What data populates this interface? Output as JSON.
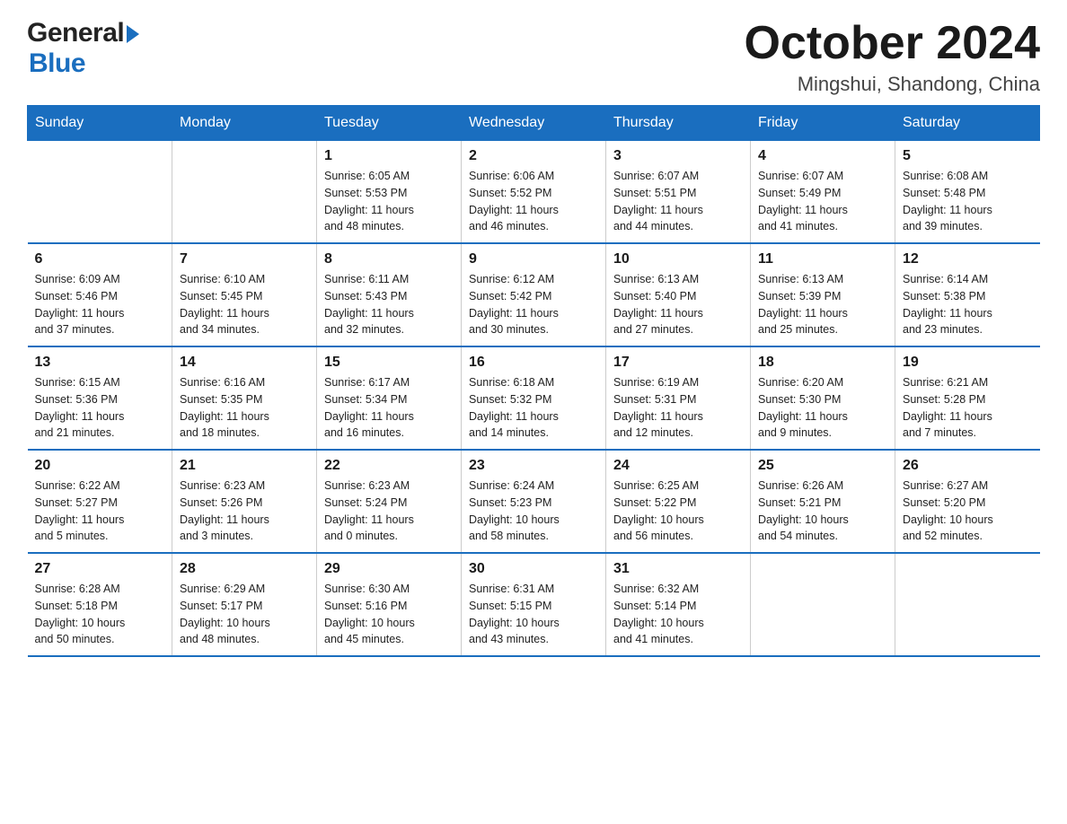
{
  "header": {
    "logo_general": "General",
    "logo_blue": "Blue",
    "month_title": "October 2024",
    "location": "Mingshui, Shandong, China"
  },
  "calendar": {
    "days_of_week": [
      "Sunday",
      "Monday",
      "Tuesday",
      "Wednesday",
      "Thursday",
      "Friday",
      "Saturday"
    ],
    "weeks": [
      [
        {
          "day": "",
          "info": ""
        },
        {
          "day": "",
          "info": ""
        },
        {
          "day": "1",
          "info": "Sunrise: 6:05 AM\nSunset: 5:53 PM\nDaylight: 11 hours\nand 48 minutes."
        },
        {
          "day": "2",
          "info": "Sunrise: 6:06 AM\nSunset: 5:52 PM\nDaylight: 11 hours\nand 46 minutes."
        },
        {
          "day": "3",
          "info": "Sunrise: 6:07 AM\nSunset: 5:51 PM\nDaylight: 11 hours\nand 44 minutes."
        },
        {
          "day": "4",
          "info": "Sunrise: 6:07 AM\nSunset: 5:49 PM\nDaylight: 11 hours\nand 41 minutes."
        },
        {
          "day": "5",
          "info": "Sunrise: 6:08 AM\nSunset: 5:48 PM\nDaylight: 11 hours\nand 39 minutes."
        }
      ],
      [
        {
          "day": "6",
          "info": "Sunrise: 6:09 AM\nSunset: 5:46 PM\nDaylight: 11 hours\nand 37 minutes."
        },
        {
          "day": "7",
          "info": "Sunrise: 6:10 AM\nSunset: 5:45 PM\nDaylight: 11 hours\nand 34 minutes."
        },
        {
          "day": "8",
          "info": "Sunrise: 6:11 AM\nSunset: 5:43 PM\nDaylight: 11 hours\nand 32 minutes."
        },
        {
          "day": "9",
          "info": "Sunrise: 6:12 AM\nSunset: 5:42 PM\nDaylight: 11 hours\nand 30 minutes."
        },
        {
          "day": "10",
          "info": "Sunrise: 6:13 AM\nSunset: 5:40 PM\nDaylight: 11 hours\nand 27 minutes."
        },
        {
          "day": "11",
          "info": "Sunrise: 6:13 AM\nSunset: 5:39 PM\nDaylight: 11 hours\nand 25 minutes."
        },
        {
          "day": "12",
          "info": "Sunrise: 6:14 AM\nSunset: 5:38 PM\nDaylight: 11 hours\nand 23 minutes."
        }
      ],
      [
        {
          "day": "13",
          "info": "Sunrise: 6:15 AM\nSunset: 5:36 PM\nDaylight: 11 hours\nand 21 minutes."
        },
        {
          "day": "14",
          "info": "Sunrise: 6:16 AM\nSunset: 5:35 PM\nDaylight: 11 hours\nand 18 minutes."
        },
        {
          "day": "15",
          "info": "Sunrise: 6:17 AM\nSunset: 5:34 PM\nDaylight: 11 hours\nand 16 minutes."
        },
        {
          "day": "16",
          "info": "Sunrise: 6:18 AM\nSunset: 5:32 PM\nDaylight: 11 hours\nand 14 minutes."
        },
        {
          "day": "17",
          "info": "Sunrise: 6:19 AM\nSunset: 5:31 PM\nDaylight: 11 hours\nand 12 minutes."
        },
        {
          "day": "18",
          "info": "Sunrise: 6:20 AM\nSunset: 5:30 PM\nDaylight: 11 hours\nand 9 minutes."
        },
        {
          "day": "19",
          "info": "Sunrise: 6:21 AM\nSunset: 5:28 PM\nDaylight: 11 hours\nand 7 minutes."
        }
      ],
      [
        {
          "day": "20",
          "info": "Sunrise: 6:22 AM\nSunset: 5:27 PM\nDaylight: 11 hours\nand 5 minutes."
        },
        {
          "day": "21",
          "info": "Sunrise: 6:23 AM\nSunset: 5:26 PM\nDaylight: 11 hours\nand 3 minutes."
        },
        {
          "day": "22",
          "info": "Sunrise: 6:23 AM\nSunset: 5:24 PM\nDaylight: 11 hours\nand 0 minutes."
        },
        {
          "day": "23",
          "info": "Sunrise: 6:24 AM\nSunset: 5:23 PM\nDaylight: 10 hours\nand 58 minutes."
        },
        {
          "day": "24",
          "info": "Sunrise: 6:25 AM\nSunset: 5:22 PM\nDaylight: 10 hours\nand 56 minutes."
        },
        {
          "day": "25",
          "info": "Sunrise: 6:26 AM\nSunset: 5:21 PM\nDaylight: 10 hours\nand 54 minutes."
        },
        {
          "day": "26",
          "info": "Sunrise: 6:27 AM\nSunset: 5:20 PM\nDaylight: 10 hours\nand 52 minutes."
        }
      ],
      [
        {
          "day": "27",
          "info": "Sunrise: 6:28 AM\nSunset: 5:18 PM\nDaylight: 10 hours\nand 50 minutes."
        },
        {
          "day": "28",
          "info": "Sunrise: 6:29 AM\nSunset: 5:17 PM\nDaylight: 10 hours\nand 48 minutes."
        },
        {
          "day": "29",
          "info": "Sunrise: 6:30 AM\nSunset: 5:16 PM\nDaylight: 10 hours\nand 45 minutes."
        },
        {
          "day": "30",
          "info": "Sunrise: 6:31 AM\nSunset: 5:15 PM\nDaylight: 10 hours\nand 43 minutes."
        },
        {
          "day": "31",
          "info": "Sunrise: 6:32 AM\nSunset: 5:14 PM\nDaylight: 10 hours\nand 41 minutes."
        },
        {
          "day": "",
          "info": ""
        },
        {
          "day": "",
          "info": ""
        }
      ]
    ]
  }
}
